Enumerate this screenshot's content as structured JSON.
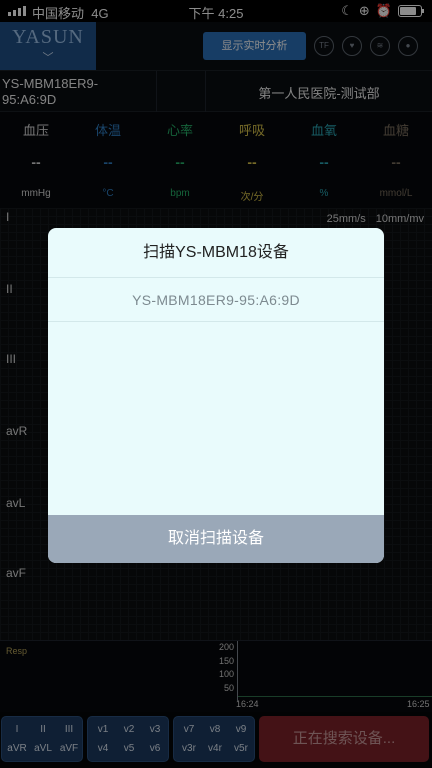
{
  "status_bar": {
    "carrier": "中国移动",
    "network": "4G",
    "time": "下午 4:25",
    "icons": [
      "moon-icon",
      "rotation-lock-icon",
      "alarm-icon",
      "battery-icon"
    ],
    "battery_level": 0.8
  },
  "header": {
    "brand": "YASUN",
    "realtime_button": "显示实时分析",
    "icons": [
      {
        "name": "tf-card-icon",
        "glyph": "TF"
      },
      {
        "name": "heart-icon",
        "glyph": "♥"
      },
      {
        "name": "wifi-icon",
        "glyph": "≋"
      },
      {
        "name": "record-icon",
        "glyph": "●"
      }
    ]
  },
  "device": {
    "id": "YS-MBM18ER9-95:A6:9D",
    "hospital": "第一人民医院-测试部"
  },
  "vitals": [
    {
      "name": "血压",
      "value": "--",
      "unit": "mmHg",
      "color": "#d6d6d6"
    },
    {
      "name": "体温",
      "value": "--",
      "unit": "°C",
      "color": "#2f7fc4"
    },
    {
      "name": "心率",
      "value": "--",
      "unit": "bpm",
      "color": "#27b36a"
    },
    {
      "name": "呼吸",
      "value": "--",
      "unit": "次/分",
      "color": "#d8c34a"
    },
    {
      "name": "血氧",
      "value": "--",
      "unit": "%",
      "color": "#2aa7b5"
    },
    {
      "name": "血糖",
      "value": "--",
      "unit": "mmol/L",
      "color": "#7a6e5e"
    }
  ],
  "ecg": {
    "speed": "25mm/s",
    "gain": "10mm/mv",
    "leads": [
      "I",
      "II",
      "III",
      "avR",
      "avL",
      "avF"
    ]
  },
  "resp": {
    "label": "Resp",
    "y_ticks": [
      "200",
      "150",
      "100",
      "50"
    ],
    "x_ticks": [
      "16:24",
      "16:25"
    ]
  },
  "lead_groups": [
    [
      "I",
      "II",
      "III",
      "aVR",
      "aVL",
      "aVF"
    ],
    [
      "v1",
      "v2",
      "v3",
      "v4",
      "v5",
      "v6"
    ],
    [
      "v7",
      "v8",
      "v9",
      "v3r",
      "v4r",
      "v5r"
    ]
  ],
  "search_button": "正在搜索设备...",
  "dialog": {
    "title": "扫描YS-MBM18设备",
    "items": [
      "YS-MBM18ER9-95:A6:9D"
    ],
    "cancel": "取消扫描设备"
  }
}
